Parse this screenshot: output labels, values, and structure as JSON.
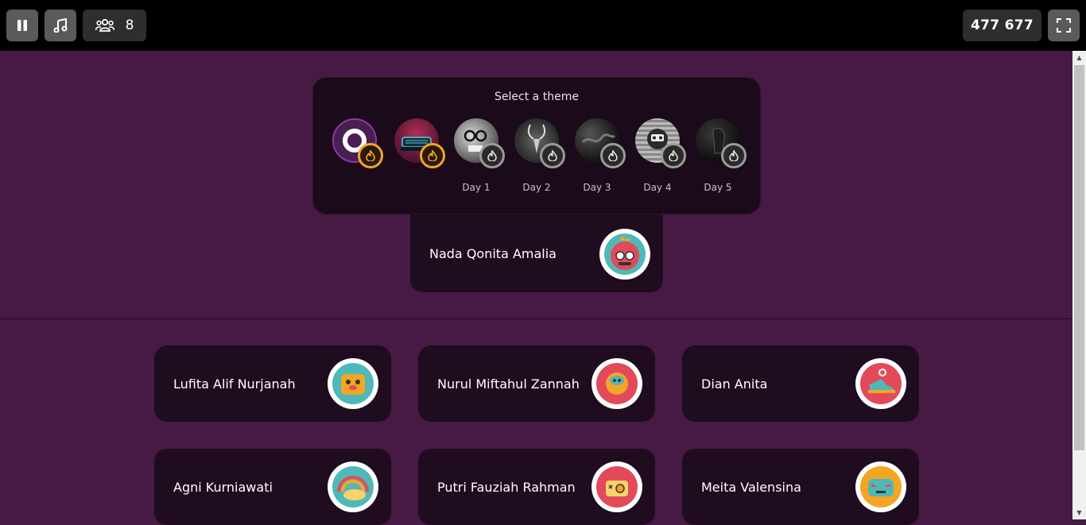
{
  "topbar": {
    "player_count": "8",
    "score": "477 677"
  },
  "themes": {
    "title": "Select a theme",
    "items": [
      {
        "day": "",
        "name": "default"
      },
      {
        "day": "",
        "name": "neon-car"
      },
      {
        "day": "Day 1",
        "name": "skull-glasses"
      },
      {
        "day": "Day 2",
        "name": "antelope"
      },
      {
        "day": "Day 3",
        "name": "dark-smoke"
      },
      {
        "day": "Day 4",
        "name": "90s-robot"
      },
      {
        "day": "Day 5",
        "name": "shadow-figure"
      }
    ]
  },
  "host": {
    "name": "Nada Qonita Amalia"
  },
  "players": [
    {
      "name": "Lufita Alif Nurjanah"
    },
    {
      "name": "Nurul Miftahul Zannah"
    },
    {
      "name": "Dian Anita"
    },
    {
      "name": "Agni Kurniawati"
    },
    {
      "name": "Putri Fauziah Rahman"
    },
    {
      "name": "Meita Valensina"
    }
  ]
}
